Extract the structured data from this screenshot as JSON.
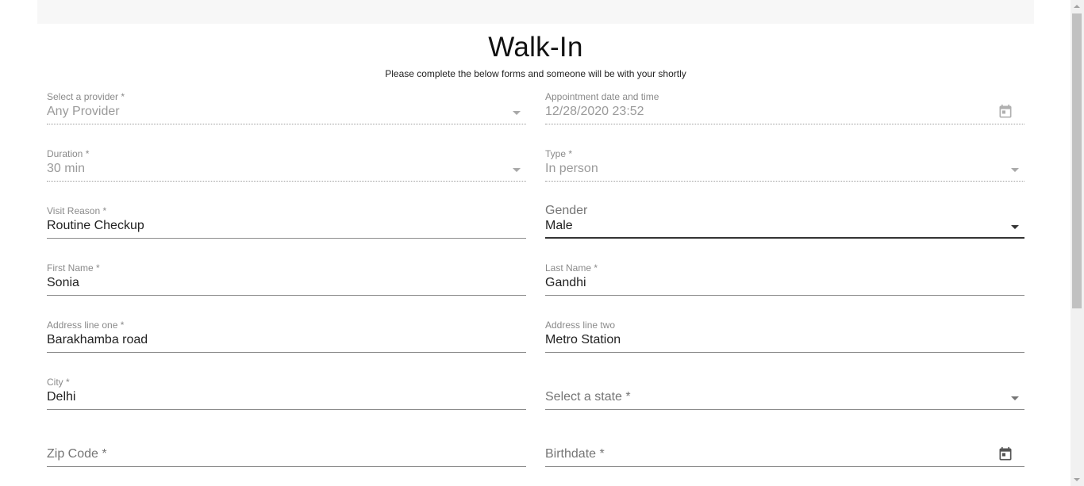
{
  "header": {
    "title": "Walk-In",
    "subtitle": "Please complete the below forms and someone will be with your shortly"
  },
  "form": {
    "provider": {
      "label": "Select a provider *",
      "value": "Any Provider"
    },
    "appointment": {
      "label": "Appointment date and time",
      "value": "12/28/2020 23:52",
      "icon": "calendar-icon"
    },
    "duration": {
      "label": "Duration *",
      "value": "30 min"
    },
    "type": {
      "label": "Type *",
      "value": "In person"
    },
    "visit_reason": {
      "label": "Visit Reason *",
      "value": "Routine Checkup"
    },
    "gender": {
      "label": "Gender",
      "value": "Male"
    },
    "first_name": {
      "label": "First Name *",
      "value": "Sonia"
    },
    "last_name": {
      "label": "Last Name *",
      "value": "Gandhi"
    },
    "address_one": {
      "label": "Address line one *",
      "value": "Barakhamba road"
    },
    "address_two": {
      "label": "Address line two",
      "value": "Metro Station"
    },
    "city": {
      "label": "City *",
      "value": "Delhi"
    },
    "state": {
      "placeholder": "Select a state *"
    },
    "zip": {
      "placeholder": "Zip Code *"
    },
    "birthdate": {
      "placeholder": "Birthdate *",
      "icon": "calendar-icon"
    }
  },
  "colors": {
    "label": "#8a8a8a",
    "disabled_text": "#9a9a9a",
    "text": "#222222",
    "underline": "#8c8c8c"
  }
}
